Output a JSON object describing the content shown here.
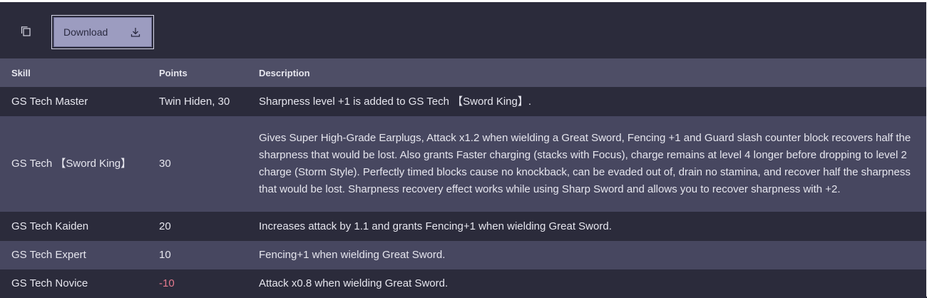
{
  "toolbar": {
    "download_label": "Download"
  },
  "table": {
    "headers": {
      "skill": "Skill",
      "points": "Points",
      "description": "Description"
    },
    "rows": [
      {
        "skill": "GS Tech Master",
        "points": "Twin Hiden, 30",
        "description": "Sharpness level +1 is added to GS Tech 【Sword King】."
      },
      {
        "skill": "GS Tech 【Sword King】",
        "points": "30",
        "description": "Gives Super High-Grade Earplugs, Attack x1.2 when wielding a Great Sword, Fencing +1 and Guard slash counter block recovers half the sharpness that would be lost. Also grants Faster charging (stacks with Focus), charge remains at level 4 longer before dropping to level 2 charge (Storm Style). Perfectly timed blocks cause no knockback, can be evaded out of, drain no stamina, and recover half the sharpness that would be lost. Sharpness recovery effect works while using Sharp Sword and allows you to recover sharpness with +2."
      },
      {
        "skill": "GS Tech Kaiden",
        "points": "20",
        "description": "Increases attack by 1.1 and grants Fencing+1 when wielding Great Sword."
      },
      {
        "skill": "GS Tech Expert",
        "points": "10",
        "description": "Fencing+1 when wielding Great Sword."
      },
      {
        "skill": "GS Tech Novice",
        "points": "-10",
        "description": "Attack x0.8 when wielding Great Sword."
      }
    ]
  },
  "colors": {
    "background": "#2b2b3b",
    "header_row": "#4e4e66",
    "alt_row": "#474760",
    "negative_points": "#e57a8e",
    "download_button": "#9c9cc0"
  },
  "icons": {
    "copy": "copy-icon",
    "download": "download-icon"
  }
}
